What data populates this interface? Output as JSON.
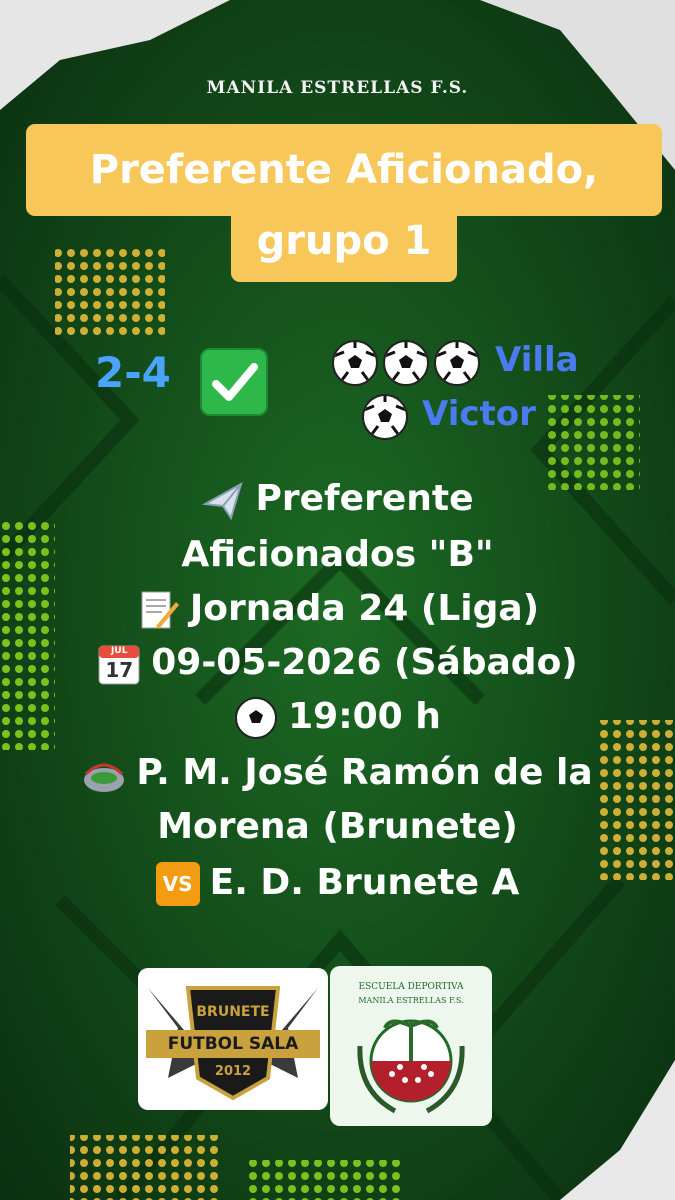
{
  "header": {
    "club_name": "MANILA ESTRELLAS F.S.",
    "title_line1": "Preferente Aficionado,",
    "title_line2": "grupo 1"
  },
  "result": {
    "score": "2-4",
    "scorers": [
      {
        "name": "Villa",
        "goals": 3
      },
      {
        "name": "Victor",
        "goals": 1
      }
    ]
  },
  "next_match": {
    "competition_line1": "Preferente",
    "competition_line2": "Aficionados \"B\"",
    "round": "Jornada 24 (Liga)",
    "calendar_month": "JUL",
    "calendar_day": "17",
    "date": "09-05-2026 (Sábado)",
    "time": "19:00 h",
    "venue_line1": "P. M. José Ramón de la",
    "venue_line2": "Morena (Brunete)",
    "vs_label": "VS",
    "opponent": "E. D. Brunete A"
  },
  "logos": {
    "left": {
      "top_text": "BRUNETE",
      "band_text": "FUTBOL SALA",
      "year": "2012"
    },
    "right": {
      "arc_line1": "ESCUELA DEPORTIVA",
      "arc_line2": "MANILA ESTRELLAS F.S."
    }
  },
  "colors": {
    "background": "#0e3d14",
    "title_box": "#f7c75a",
    "score": "#4aa3ff",
    "scorer": "#4a7cf0",
    "accent_dots": "#8fd81f"
  }
}
